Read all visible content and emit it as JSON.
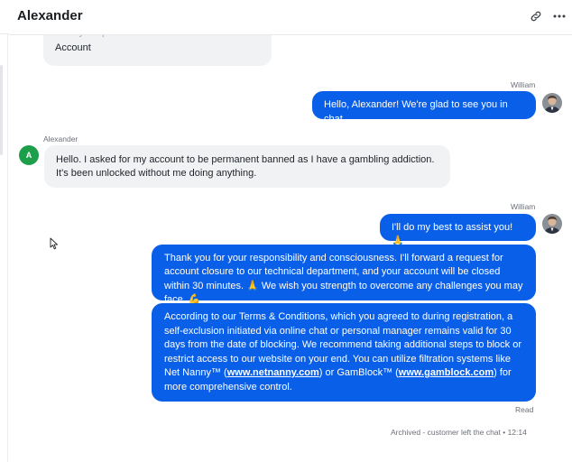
{
  "header": {
    "title": "Alexander",
    "link_icon": "link-icon",
    "more_icon": "more-dots-icon"
  },
  "messages": {
    "m0": {
      "partial": "Enter your question:",
      "text": "Account"
    },
    "m1": {
      "sender": "William",
      "text": "Hello, Alexander! We're glad to see you in chat."
    },
    "m2": {
      "sender": "Alexander",
      "avatar_letter": "A",
      "text": "Hello. I asked for my account to be permanent banned as I have a gambling addiction. It's been unlocked without me doing anything."
    },
    "m3": {
      "sender": "William",
      "text": "I'll do my best to assist you! 🙏"
    },
    "m4": {
      "text": "Thank you for your responsibility and consciousness. I'll forward a request for account closure to our technical department, and your account will be closed within 30 minutes. 🙏 We wish you strength to overcome any challenges you may face. 💪"
    },
    "m5": {
      "text_a": "According to our Terms & Conditions, which you agreed to during registration, a self-exclusion initiated via online chat or personal manager remains valid for 30 days from the date of blocking. We recommend taking additional steps to block or restrict access to our website on your end. You can utilize filtration systems like Net Nanny™ (",
      "link1": "www.netnanny.com",
      "text_b": ") or GamBlock™ (",
      "link2": "www.gamblock.com",
      "text_c": ") for more comprehensive control."
    }
  },
  "status": {
    "read": "Read",
    "archived": "Archived - customer left the chat • 12:14"
  },
  "colors": {
    "outgoing_bubble": "#0a5fe8",
    "incoming_bubble": "#f1f2f4",
    "customer_avatar": "#1d9e4b"
  }
}
